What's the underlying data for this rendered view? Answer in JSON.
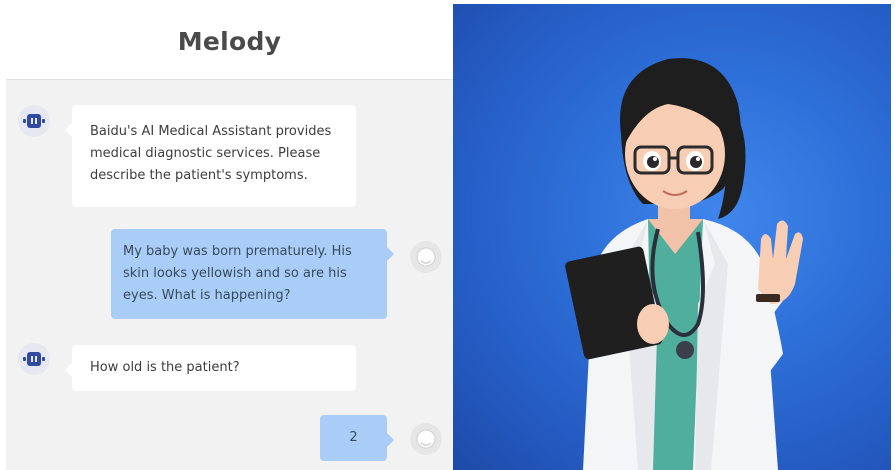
{
  "chat": {
    "title": "Melody",
    "messages": [
      {
        "sender": "bot",
        "text": "Baidu's AI Medical Assistant provides medical diagnostic services. Please describe the patient's symptoms."
      },
      {
        "sender": "user",
        "text": "My baby was born prematurely. His skin looks yellowish and so are his eyes. What is happening?"
      },
      {
        "sender": "bot",
        "text": "How old is the patient?"
      },
      {
        "sender": "user",
        "text": "2"
      }
    ]
  },
  "icons": {
    "bot_avatar": "robot-icon",
    "user_avatar": "user-icon",
    "clipboard": "clipboard-icon",
    "stethoscope": "stethoscope-icon"
  },
  "colors": {
    "user_bubble": "#a9cdf6",
    "bot_bubble": "#ffffff",
    "chat_bg": "#f2f2f2",
    "hero_bg": "#2d6fd8",
    "coat": "#f4f5f7",
    "scrubs": "#4fae9c"
  }
}
